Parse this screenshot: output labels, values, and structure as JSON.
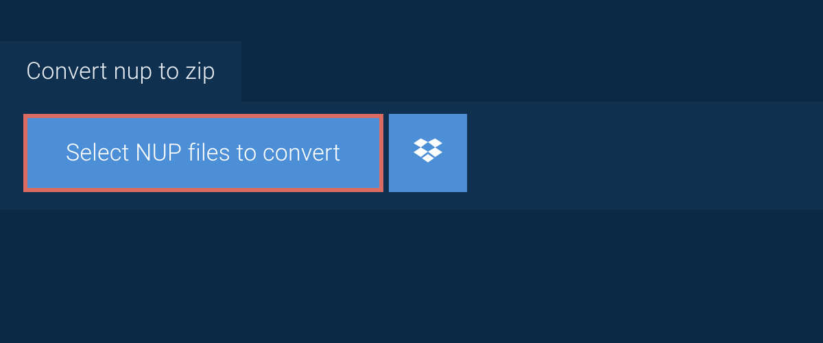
{
  "tab": {
    "title": "Convert nup to zip"
  },
  "buttons": {
    "select_files_label": "Select NUP files to convert",
    "dropbox_icon": "dropbox-icon"
  },
  "colors": {
    "background": "#0b2844",
    "panel": "#10304f",
    "button": "#4c8fd6",
    "highlight_border": "#dc6b61"
  }
}
